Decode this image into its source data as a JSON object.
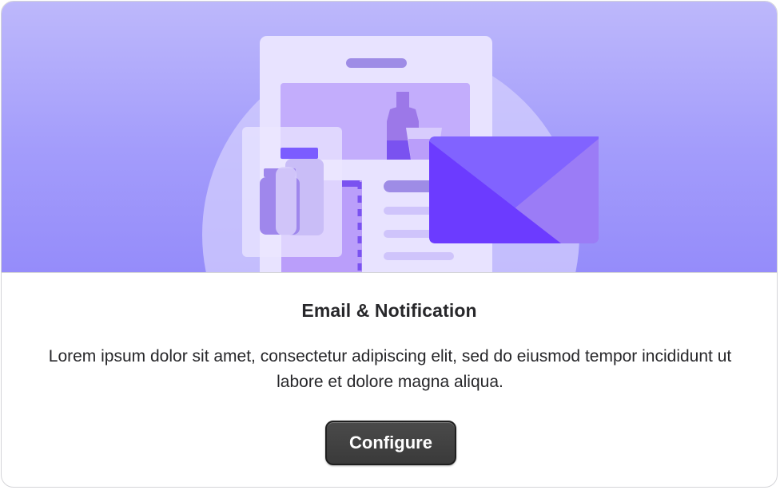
{
  "card": {
    "title": "Email & Notification",
    "description": "Lorem ipsum dolor sit amet, consectetur adipiscing elit, sed do eiusmod tempor incididunt ut labore et dolore magna aliqua.",
    "button_label": "Configure"
  },
  "colors": {
    "hero_top": "#bdb8fb",
    "hero_bottom": "#958cfa",
    "envelope": "#7b5cff",
    "button_bg": "#3f3f3f",
    "text": "#27272a"
  }
}
